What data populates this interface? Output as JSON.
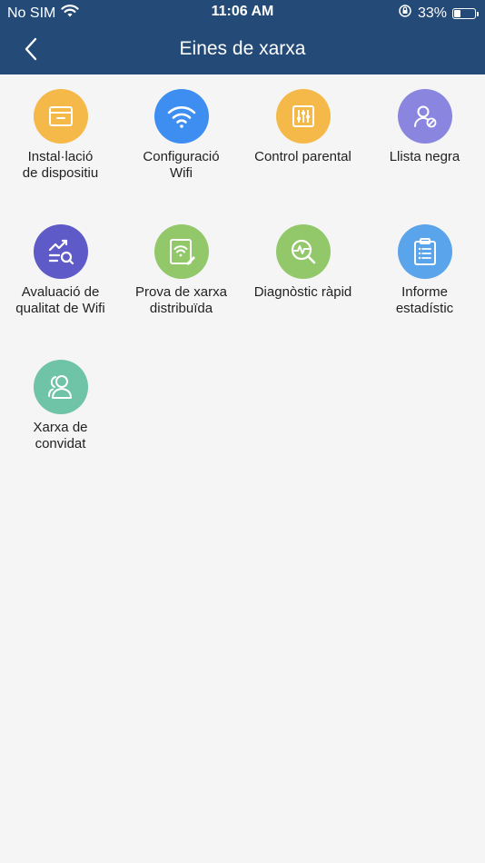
{
  "status_bar": {
    "carrier": "No SIM",
    "time": "11:06 AM",
    "battery_percent": "33%",
    "battery_level": 0.33,
    "wifi_icon": "wifi-icon",
    "lock_icon": "orientation-lock-icon"
  },
  "header": {
    "title": "Eines de xarxa",
    "back_icon": "chevron-left-icon",
    "background": "#244a77"
  },
  "tools": [
    {
      "label": "Instal·lació\nde dispositiu",
      "icon": "device-box-icon",
      "color": "#f5b94a"
    },
    {
      "label": "Configuració\nWifi",
      "icon": "wifi-icon",
      "color": "#3d8ef0"
    },
    {
      "label": "Control parental",
      "icon": "sliders-icon",
      "color": "#f5b94a"
    },
    {
      "label": "Llista negra",
      "icon": "user-blocked-icon",
      "color": "#8a86e0"
    },
    {
      "label": "Avaluació de\nqualitat de Wifi",
      "icon": "trend-search-icon",
      "color": "#5e5bc8"
    },
    {
      "label": "Prova de xarxa\ndistribuïda",
      "icon": "wifi-doc-edit-icon",
      "color": "#92c86a"
    },
    {
      "label": "Diagnòstic ràpid",
      "icon": "wave-search-icon",
      "color": "#92c86a"
    },
    {
      "label": "Informe\nestadístic",
      "icon": "clipboard-list-icon",
      "color": "#5aa4ec"
    },
    {
      "label": "Xarxa de\nconvidat",
      "icon": "guests-icon",
      "color": "#6fc3a6"
    }
  ]
}
